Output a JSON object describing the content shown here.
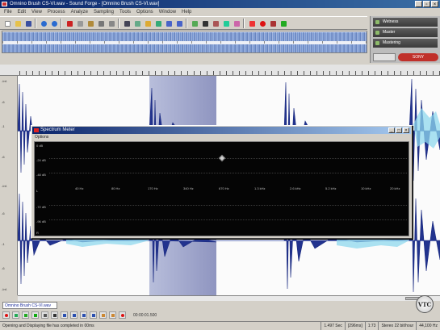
{
  "window": {
    "title": "Omnino Brush CS-VI.wav - Sound Forge - [Omnino Brush CS-VI.wav]",
    "controls": [
      "_",
      "▫",
      "×"
    ]
  },
  "menu": [
    "File",
    "Edit",
    "View",
    "Process",
    "Analyze",
    "Sampling",
    "Tools",
    "Options",
    "Window",
    "Help"
  ],
  "right_panel": {
    "items": [
      "Wetness",
      "Master",
      "Mastering"
    ],
    "brand": "SONY"
  },
  "ruler": {
    "labels": [
      "",
      "",
      "",
      "",
      "",
      "",
      ""
    ]
  },
  "left_scale": [
    "-Inf.",
    "-6",
    "-1",
    "-6",
    "-Inf.",
    "-6",
    "-1",
    "-6",
    "-Inf."
  ],
  "spectrum": {
    "title": "Spectrum Meter",
    "menu": "Options",
    "controls": [
      "_",
      "□",
      "×"
    ],
    "db_labels": [
      "0 dB",
      "-24 dB",
      "-48 dB",
      "-72 dB",
      "-96 dB",
      "-120 dB"
    ],
    "channel_labels": [
      "L",
      "R"
    ],
    "freq_labels": [
      "40 Hz",
      "80 Hz",
      "170 Hz",
      "340 Hz",
      "670 Hz",
      "1.3 kHz",
      "2.6 kHz",
      "5.2 kHz",
      "10 kHz",
      "20 kHz"
    ]
  },
  "doc_tab": "Omnino Brush CS-VI.wav",
  "transport": {
    "readout": "00:00:01.500"
  },
  "logo": "VTC",
  "status": {
    "message": "Opening and Displaying file has completed in 00ms",
    "cells": [
      "1.497 Sec",
      "[296ms]",
      "1:73",
      "Stereo 22 bit/hour",
      "44,100 Hz"
    ]
  },
  "colors": {
    "title_bar": "#0a246a",
    "waveform": "#1f2f8f",
    "selection": "#9aa0c8",
    "spectrum_bg": "#050505"
  }
}
